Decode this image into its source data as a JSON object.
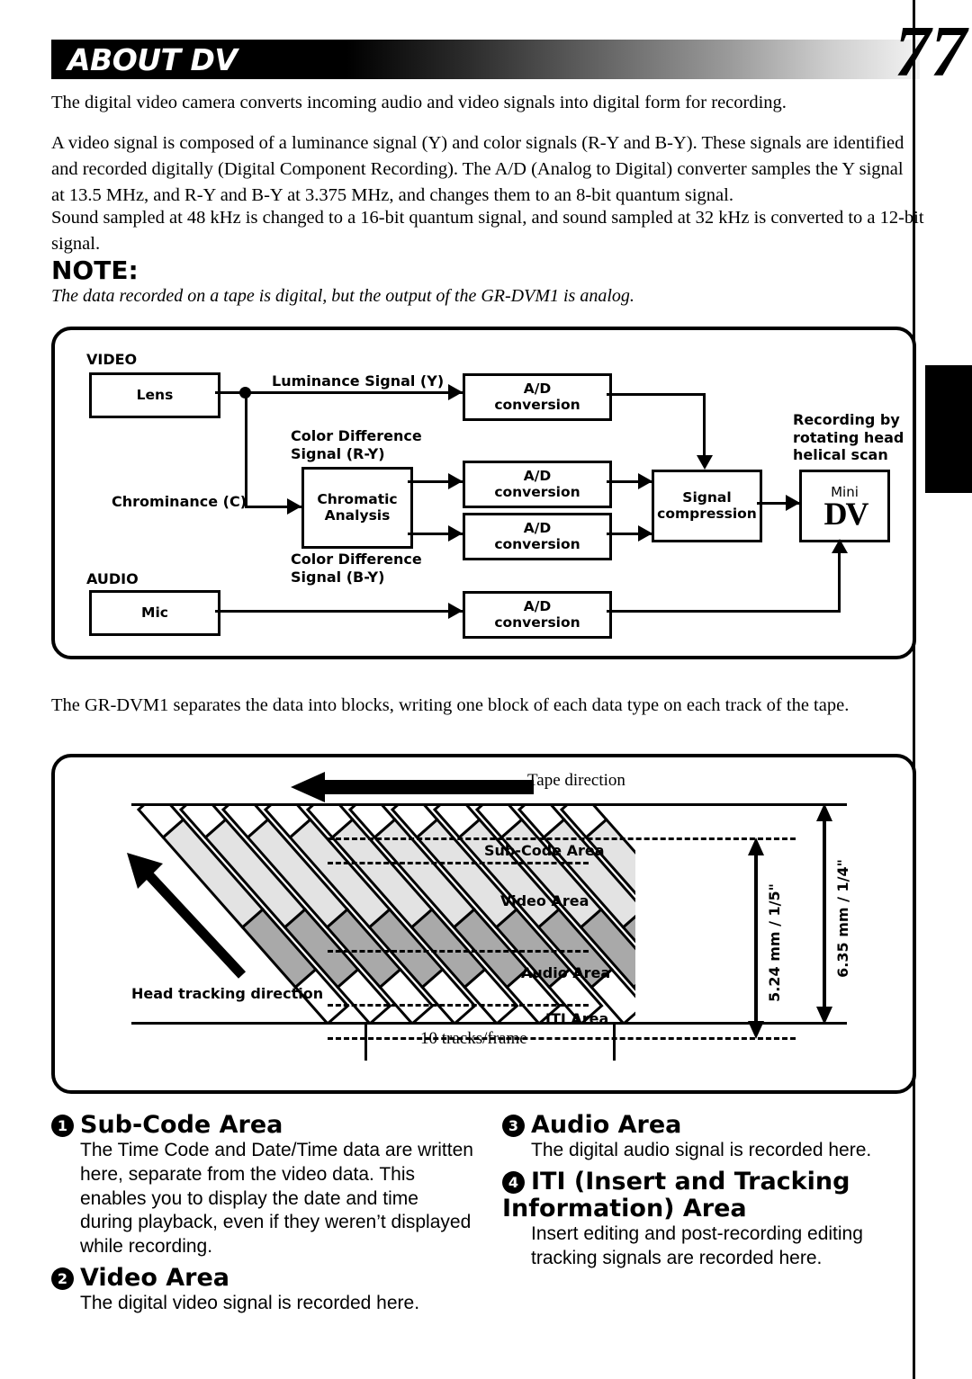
{
  "header": {
    "title": "ABOUT DV",
    "page_number": "77"
  },
  "paragraphs": {
    "p1": "The digital video camera converts incoming audio and video signals into digital form for recording.",
    "p2": "A video signal is composed of a luminance signal (Y) and color signals (R-Y and B-Y). These signals are identified and recorded digitally (Digital Component Recording). The A/D (Analog to Digital) converter samples the Y signal at 13.5 MHz, and R-Y and B-Y at 3.375 MHz, and changes them to an 8-bit quantum signal.",
    "p3": "Sound sampled at 48 kHz is changed to a 16-bit quantum signal, and sound sampled at 32 kHz is converted to a 12-bit signal.",
    "p4": "The GR-DVM1 separates the data into blocks, writing one block of each data type on each track of the tape."
  },
  "note": {
    "heading": "NOTE:",
    "text": "The data recorded on a tape is digital, but the output of the GR-DVM1 is analog."
  },
  "signal_flow_diagram": {
    "section_video": "VIDEO",
    "section_audio": "AUDIO",
    "lens": "Lens",
    "mic": "Mic",
    "chromatic_analysis_line1": "Chromatic",
    "chromatic_analysis_line2": "Analysis",
    "signal_compression_line1": "Signal",
    "signal_compression_line2": "compression",
    "ad_line1": "A/D",
    "ad_line2": "conversion",
    "ad_y": "A/D conversion",
    "ad_ry": "A/D conversion",
    "ad_by": "A/D conversion",
    "ad_audio": "A/D conversion",
    "label_luminance": "Luminance Signal (Y)",
    "label_colordiff_ry_line1": "Color Difference",
    "label_colordiff_ry_line2": "Signal (R-Y)",
    "label_colordiff_by_line1": "Color Difference",
    "label_colordiff_by_line2": "Signal (B-Y)",
    "label_chrominance": "Chrominance (C)",
    "label_recording_line1": "Recording by",
    "label_recording_line2": "rotating head",
    "label_recording_line3": "helical scan",
    "minidv_mini": "Mini",
    "minidv_dv": "DV"
  },
  "tape_diagram": {
    "tape_direction": "Tape direction",
    "head_tracking_direction": "Head tracking direction",
    "tracks_per_frame": "10 tracks/frame",
    "area_subcode": "Sub-Code Area",
    "area_video": "Video Area",
    "area_audio": "Audio Area",
    "area_iti": "ITI Area",
    "dimension_inner": "5.24 mm / 1/5\"",
    "dimension_outer": "6.35 mm / 1/4\"",
    "track_count": 11,
    "colors": {
      "subcode_fill": "#ffffff",
      "video_fill": "#e3e3e3",
      "audio_fill": "#a9a9a9",
      "iti_fill": "#ffffff",
      "stroke": "#000000"
    }
  },
  "area_descriptions": [
    {
      "number": "1",
      "title": "Sub-Code Area",
      "body": "The Time Code and Date/Time data are written here, separate from the video data. This enables you to display the date and time during playback, even if they weren’t displayed while recording."
    },
    {
      "number": "2",
      "title": "Video Area",
      "body": "The digital video signal is recorded here."
    },
    {
      "number": "3",
      "title": "Audio Area",
      "body": "The digital audio signal is recorded here."
    },
    {
      "number": "4",
      "title": "ITI (Insert and Tracking Information) Area",
      "body": "Insert editing and post-recording editing tracking signals are recorded here."
    }
  ]
}
